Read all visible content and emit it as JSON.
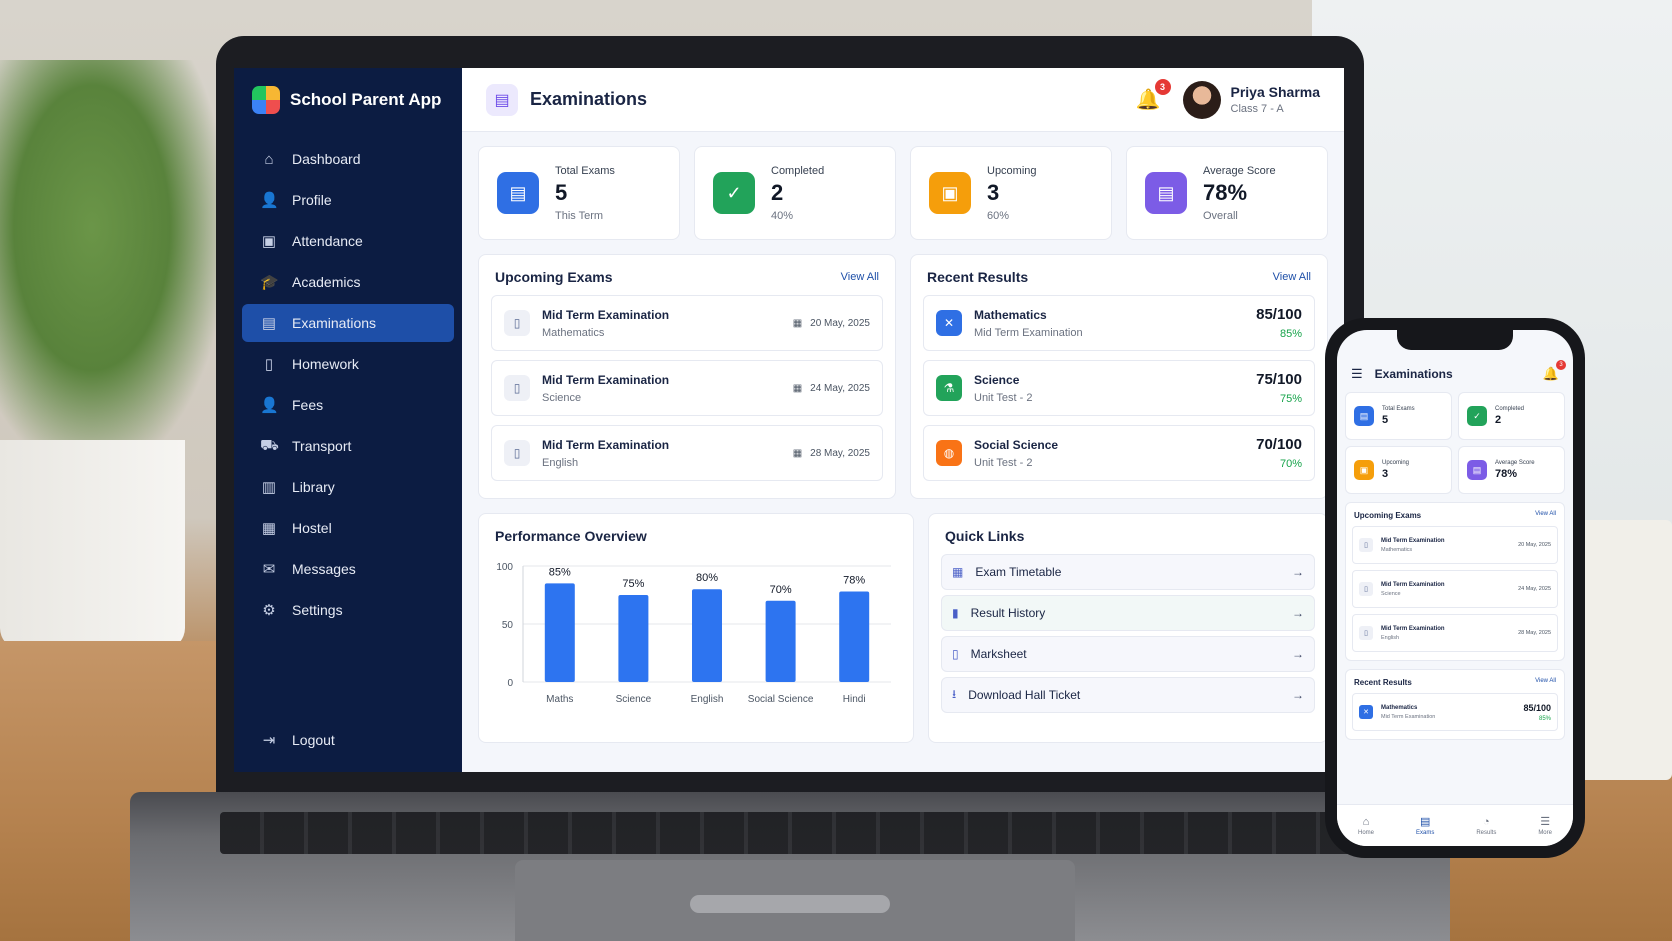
{
  "app": {
    "name": "School Parent App"
  },
  "sidebar": {
    "items": [
      {
        "label": "Dashboard",
        "icon": "home-icon",
        "glyph": "⌂"
      },
      {
        "label": "Profile",
        "icon": "user-icon",
        "glyph": "👤"
      },
      {
        "label": "Attendance",
        "icon": "calendar-check-icon",
        "glyph": "▣"
      },
      {
        "label": "Academics",
        "icon": "graduation-cap-icon",
        "glyph": "🎓"
      },
      {
        "label": "Examinations",
        "icon": "clipboard-icon",
        "glyph": "▤"
      },
      {
        "label": "Homework",
        "icon": "document-icon",
        "glyph": "▯"
      },
      {
        "label": "Fees",
        "icon": "fees-user-icon",
        "glyph": "👤"
      },
      {
        "label": "Transport",
        "icon": "bus-icon",
        "glyph": "⛟"
      },
      {
        "label": "Library",
        "icon": "book-icon",
        "glyph": "▥"
      },
      {
        "label": "Hostel",
        "icon": "building-icon",
        "glyph": "▦"
      },
      {
        "label": "Messages",
        "icon": "mail-icon",
        "glyph": "✉"
      },
      {
        "label": "Settings",
        "icon": "gear-icon",
        "glyph": "⚙"
      }
    ],
    "active_index": 4,
    "logout": "Logout"
  },
  "header": {
    "title": "Examinations",
    "notifications": "3",
    "user_name": "Priya Sharma",
    "user_class": "Class 7 - A"
  },
  "stats": [
    {
      "label": "Total Exams",
      "value": "5",
      "sub": "This Term",
      "color": "#2f6fe4",
      "glyph": "▤"
    },
    {
      "label": "Completed",
      "value": "2",
      "sub": "40%",
      "color": "#22a35a",
      "glyph": "✓"
    },
    {
      "label": "Upcoming",
      "value": "3",
      "sub": "60%",
      "color": "#f59e0b",
      "glyph": "▣"
    },
    {
      "label": "Average Score",
      "value": "78%",
      "sub": "Overall",
      "color": "#7c5ce6",
      "glyph": "▤"
    }
  ],
  "upcoming": {
    "title": "Upcoming Exams",
    "view_all": "View All",
    "items": [
      {
        "title": "Mid Term Examination",
        "subject": "Mathematics",
        "date": "20 May, 2025"
      },
      {
        "title": "Mid Term Examination",
        "subject": "Science",
        "date": "24 May, 2025"
      },
      {
        "title": "Mid Term Examination",
        "subject": "English",
        "date": "28 May, 2025"
      }
    ]
  },
  "results": {
    "title": "Recent Results",
    "view_all": "View All",
    "items": [
      {
        "subject": "Mathematics",
        "exam": "Mid Term Examination",
        "score": "85/100",
        "pct": "85%",
        "color": "#2f6fe4",
        "glyph": "✕"
      },
      {
        "subject": "Science",
        "exam": "Unit Test - 2",
        "score": "75/100",
        "pct": "75%",
        "color": "#22a35a",
        "glyph": "⚗"
      },
      {
        "subject": "Social Science",
        "exam": "Unit Test - 2",
        "score": "70/100",
        "pct": "70%",
        "color": "#f97316",
        "glyph": "◍"
      }
    ]
  },
  "performance": {
    "title": "Performance Overview"
  },
  "chart_data": {
    "type": "bar",
    "categories": [
      "Maths",
      "Science",
      "English",
      "Social Science",
      "Hindi"
    ],
    "values": [
      85,
      75,
      80,
      70,
      78
    ],
    "value_labels": [
      "85%",
      "75%",
      "80%",
      "70%",
      "78%"
    ],
    "yticks": [
      "100",
      "50",
      "0"
    ],
    "ylim": [
      0,
      100
    ],
    "color": "#2d74f0",
    "grid": true
  },
  "quick_links": {
    "title": "Quick Links",
    "items": [
      {
        "label": "Exam Timetable",
        "icon": "calendar-icon",
        "glyph": "▦"
      },
      {
        "label": "Result History",
        "icon": "bar-chart-icon",
        "glyph": "▮"
      },
      {
        "label": "Marksheet",
        "icon": "document-icon",
        "glyph": "▯"
      },
      {
        "label": "Download Hall Ticket",
        "icon": "download-icon",
        "glyph": "⭳"
      }
    ]
  },
  "phone": {
    "title": "Examinations",
    "notifications": "3",
    "stats": [
      {
        "label": "Total Exams",
        "value": "5",
        "color": "#2f6fe4",
        "glyph": "▤"
      },
      {
        "label": "Completed",
        "value": "2",
        "color": "#22a35a",
        "glyph": "✓"
      },
      {
        "label": "Upcoming",
        "value": "3",
        "color": "#f59e0b",
        "glyph": "▣"
      },
      {
        "label": "Average Score",
        "value": "78%",
        "color": "#7c5ce6",
        "glyph": "▤"
      }
    ],
    "upcoming_title": "Upcoming Exams",
    "results_title": "Recent Results",
    "view_all": "View All",
    "nav": [
      {
        "label": "Home",
        "glyph": "⌂"
      },
      {
        "label": "Exams",
        "glyph": "▤"
      },
      {
        "label": "Results",
        "glyph": "◔"
      },
      {
        "label": "More",
        "glyph": "☰"
      }
    ]
  }
}
